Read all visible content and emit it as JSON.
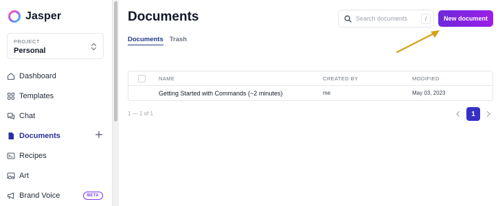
{
  "brand": {
    "name": "Jasper"
  },
  "project": {
    "label": "PROJECT",
    "name": "Personal"
  },
  "sidebar": {
    "items": [
      {
        "label": "Dashboard",
        "icon": "home-icon"
      },
      {
        "label": "Templates",
        "icon": "grid-icon"
      },
      {
        "label": "Chat",
        "icon": "chat-icon"
      },
      {
        "label": "Documents",
        "icon": "document-icon",
        "active": true
      },
      {
        "label": "Recipes",
        "icon": "terminal-icon"
      },
      {
        "label": "Art",
        "icon": "image-icon"
      },
      {
        "label": "Brand Voice",
        "icon": "megaphone-icon",
        "badge": "BETA"
      }
    ]
  },
  "main": {
    "title": "Documents",
    "search": {
      "placeholder": "Search documents",
      "shortcut": "/"
    },
    "new_button": "New document",
    "tabs": [
      {
        "label": "Documents",
        "active": true
      },
      {
        "label": "Trash",
        "active": false
      }
    ],
    "table": {
      "columns": [
        "NAME",
        "CREATED BY",
        "MODIFIED"
      ],
      "rows": [
        {
          "name": "Getting Started with Commands (~2 minutes)",
          "created_by": "me",
          "modified": "May 03, 2023"
        }
      ]
    },
    "pagination": {
      "info": "1 — 1 of 1",
      "current": "1"
    }
  },
  "colors": {
    "accent": "#7e22ce",
    "active_nav": "#2c2f9e",
    "page_button": "#3730c7",
    "annotation_arrow": "#d4a017",
    "beta_badge": "#7c3aed"
  }
}
